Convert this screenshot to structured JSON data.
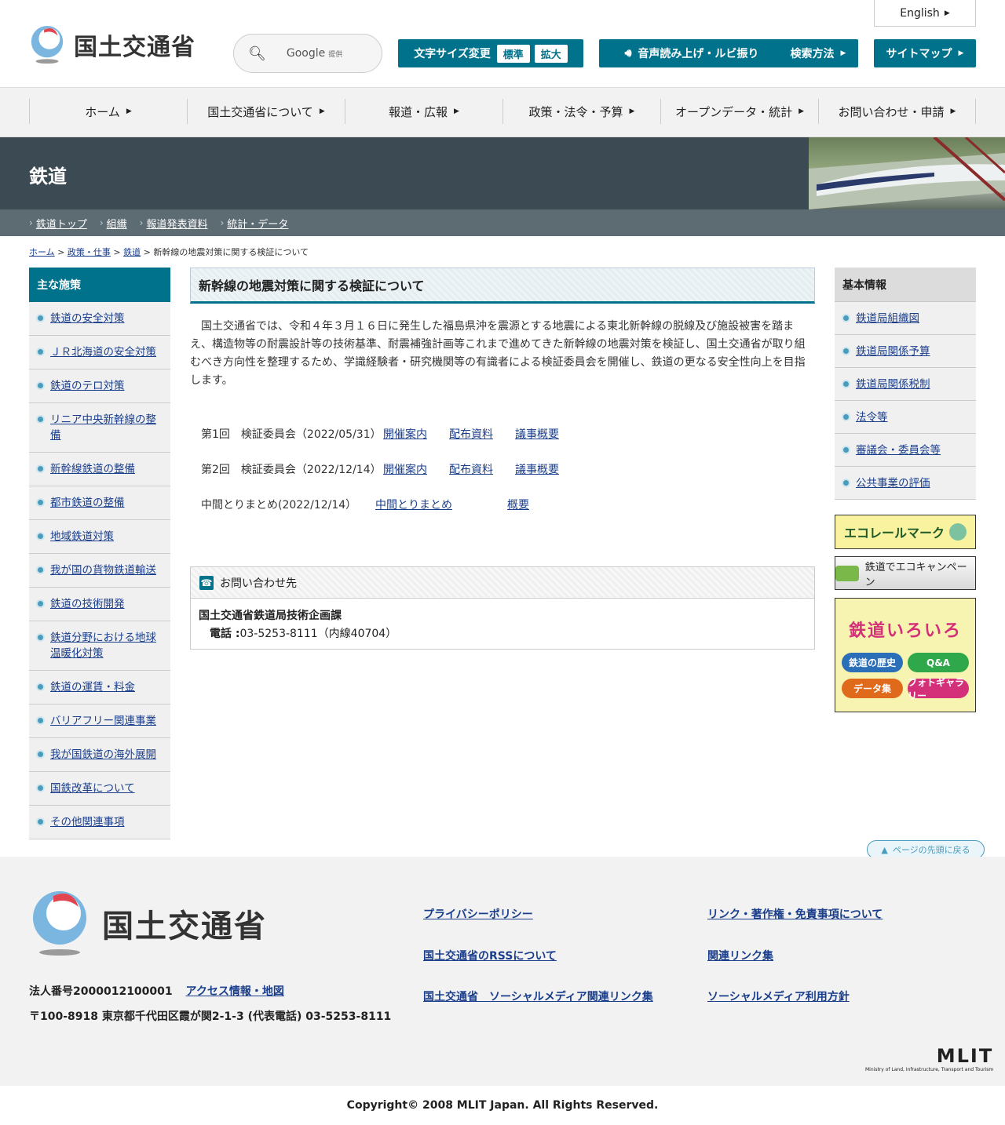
{
  "header": {
    "site_name": "国土交通省",
    "search": {
      "google_label": "Google",
      "google_sub": "提供"
    },
    "lang_button": "English",
    "font_size": {
      "label": "文字サイズ変更",
      "standard": "標準",
      "large": "拡大"
    },
    "voice_button": "音声読み上げ・ルビ振り",
    "search_method": "検索方法",
    "sitemap": "サイトマップ"
  },
  "gnav": [
    "ホーム",
    "国土交通省について",
    "報道・広報",
    "政策・法令・予算",
    "オープンデータ・統計",
    "お問い合わせ・申請"
  ],
  "banner": {
    "title": "鉄道"
  },
  "subnav": [
    "鉄道トップ",
    "組織",
    "報道発表資料",
    "統計・データ"
  ],
  "breadcrumb": {
    "home": "ホーム",
    "policy": "政策・仕事",
    "railway": "鉄道",
    "current": "新幹線の地震対策に関する検証について",
    "sep": ">"
  },
  "left_sidebar": {
    "heading": "主な施策",
    "items": [
      "鉄道の安全対策",
      "ＪＲ北海道の安全対策",
      "鉄道のテロ対策",
      "リニア中央新幹線の整備",
      "新幹線鉄道の整備",
      "都市鉄道の整備",
      "地域鉄道対策",
      "我が国の貨物鉄道輸送",
      "鉄道の技術開発",
      "鉄道分野における地球温暖化対策",
      "鉄道の運賃・料金",
      "バリアフリー関連事業",
      "我が国鉄道の海外展開",
      "国鉄改革について",
      "その他関連事項"
    ]
  },
  "main": {
    "title": "新幹線の地震対策に関する検証について",
    "lead": "国土交通省では、令和４年３月１６日に発生した福島県沖を震源とする地震による東北新幹線の脱線及び施設被害を踏まえ、構造物等の耐震設計等の技術基準、耐震補強計画等これまで進めてきた新幹線の地震対策を検証し、国土交通省が取り組むべき方向性を整理するため、学識経験者・研究機関等の有識者による検証委員会を開催し、鉄道の更なる安全性向上を目指します。",
    "meetings": [
      {
        "label": "第1回　検証委員会（2022/05/31）",
        "links": [
          "開催案内",
          "配布資料",
          "議事概要"
        ]
      },
      {
        "label": "第2回　検証委員会（2022/12/14）",
        "links": [
          "開催案内",
          "配布資料",
          "議事概要"
        ]
      },
      {
        "label": "中間とりまとめ(2022/12/14）",
        "links": [
          "中間とりまとめ",
          "概要"
        ]
      }
    ],
    "contact": {
      "heading": "お問い合わせ先",
      "org": "国土交通省鉄道局技術企画課",
      "tel_label": "電話 :",
      "tel": "03-5253-8111（内線40704）"
    }
  },
  "right_sidebar": {
    "heading": "基本情報",
    "items": [
      "鉄道局組織図",
      "鉄道局関係予算",
      "鉄道局関係税制",
      "法令等",
      "審議会・委員会等",
      "公共事業の評価"
    ],
    "banners": {
      "eco_rail": "エコレールマーク",
      "campaign": "鉄道でエコキャンペーン",
      "iroiro_title": "鉄道いろいろ",
      "iroiro_buttons": [
        "鉄道の歴史",
        "Q&A",
        "データ集",
        "フォトギャラリー"
      ]
    }
  },
  "pagetop": "ページの先頭に戻る",
  "footer": {
    "site_name": "国土交通省",
    "corp_number": "法人番号2000012100001",
    "access": "アクセス情報・地図",
    "address": "〒100-8918 東京都千代田区霞が関2-1-3 (代表電話) 03-5253-8111",
    "links": [
      "プライバシーポリシー",
      "リンク・著作権・免責事項について",
      "国土交通省のRSSについて",
      "関連リンク集",
      "国土交通省　ソーシャルメディア関連リンク集",
      "ソーシャルメディア利用方針"
    ],
    "mlit_logo": "MLIT",
    "mlit_sub": "Ministry of Land, Infrastructure, Transport and Tourism",
    "copyright": "Copyright© 2008 MLIT Japan. All Rights Reserved."
  },
  "colors": {
    "accent": "#00728b",
    "banner": "#3c4a54",
    "subnav": "#5d6b73",
    "link": "#1a3e8c"
  }
}
